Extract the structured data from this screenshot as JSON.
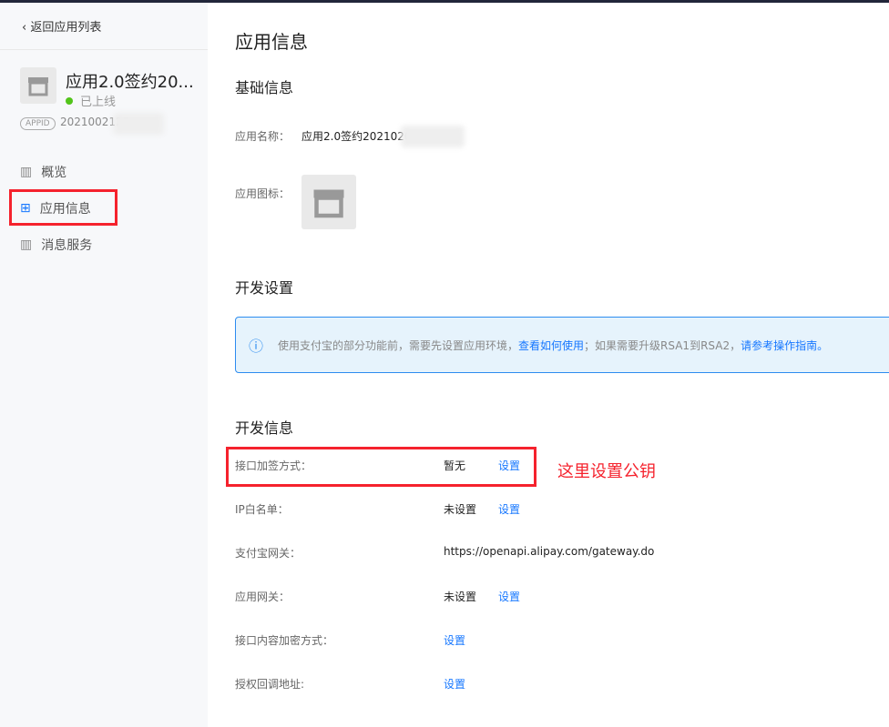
{
  "sidebar": {
    "back": "返回应用列表",
    "app_name": "应用2.0签约20...",
    "status": "已上线",
    "appid_tag": "APPID",
    "appid": "2021002127",
    "nav": [
      {
        "label": "概览",
        "icon": "chart-icon"
      },
      {
        "label": "应用信息",
        "icon": "grid-icon"
      },
      {
        "label": "消息服务",
        "icon": "chart-icon"
      }
    ]
  },
  "main": {
    "title": "应用信息",
    "basic": {
      "heading": "基础信息",
      "name_label": "应用名称：",
      "name_value": "应用2.0签约2021020",
      "icon_label": "应用图标："
    },
    "dev_settings": {
      "heading": "开发设置",
      "notice_1": "使用支付宝的部分功能前，需要先设置应用环境，",
      "notice_link1": "查看如何使用",
      "notice_2": "；如果需要升级RSA1到RSA2，",
      "notice_link2": "请参考操作指南。"
    },
    "dev_info": {
      "heading": "开发信息",
      "rows": [
        {
          "label": "接口加签方式：",
          "value": "暂无",
          "link": "设置"
        },
        {
          "label": "IP白名单：",
          "value": "未设置",
          "link": "设置"
        },
        {
          "label": "支付宝网关：",
          "value": "https://openapi.alipay.com/gateway.do",
          "link": ""
        },
        {
          "label": "应用网关：",
          "value": "未设置",
          "link": "设置"
        },
        {
          "label": "接口内容加密方式：",
          "value": "",
          "link": "设置"
        },
        {
          "label": "授权回调地址:",
          "value": "",
          "link": "设置"
        }
      ]
    }
  },
  "annotation": "这里设置公钥",
  "colors": {
    "accent": "#1677ff",
    "annotation": "#f5222d"
  }
}
